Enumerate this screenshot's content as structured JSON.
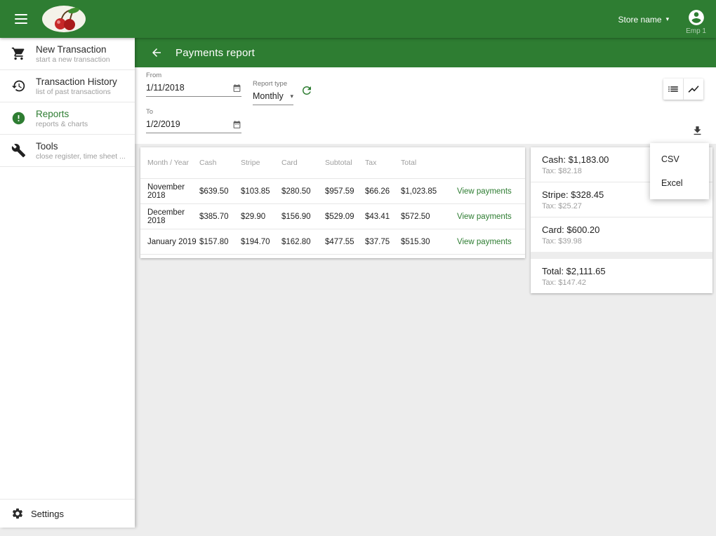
{
  "colors": {
    "accent": "#2e7d32"
  },
  "icons": {
    "caret_down": "▾"
  },
  "topbar": {
    "store_name": "Store name",
    "employee": "Emp 1"
  },
  "sidebar": {
    "items": [
      {
        "label": "New Transaction",
        "sub": "start a new transaction"
      },
      {
        "label": "Transaction History",
        "sub": "list of past transactions"
      },
      {
        "label": "Reports",
        "sub": "reports & charts"
      },
      {
        "label": "Tools",
        "sub": "close register, time sheet ..."
      }
    ],
    "settings_label": "Settings"
  },
  "header": {
    "title": "Payments report"
  },
  "filters": {
    "from_label": "From",
    "from_value": "1/11/2018",
    "to_label": "To",
    "to_value": "1/2/2019",
    "report_type_label": "Report type",
    "report_type_value": "Monthly"
  },
  "export_menu": {
    "items": [
      "CSV",
      "Excel"
    ]
  },
  "table": {
    "columns": [
      "Month / Year",
      "Cash",
      "Stripe",
      "Card",
      "Subtotal",
      "Tax",
      "Total"
    ],
    "action_label": "View payments",
    "rows": [
      [
        "November 2018",
        "$639.50",
        "$103.85",
        "$280.50",
        "$957.59",
        "$66.26",
        "$1,023.85"
      ],
      [
        "December 2018",
        "$385.70",
        "$29.90",
        "$156.90",
        "$529.09",
        "$43.41",
        "$572.50"
      ],
      [
        "January 2019",
        "$157.80",
        "$194.70",
        "$162.80",
        "$477.55",
        "$37.75",
        "$515.30"
      ]
    ]
  },
  "summary": {
    "sections": [
      {
        "label": "Cash: $1,183.00",
        "tax": "Tax: $82.18"
      },
      {
        "label": "Stripe: $328.45",
        "tax": "Tax: $25.27"
      },
      {
        "label": "Card: $600.20",
        "tax": "Tax: $39.98"
      },
      {
        "label": "Total: $2,111.65",
        "tax": "Tax: $147.42"
      }
    ]
  }
}
